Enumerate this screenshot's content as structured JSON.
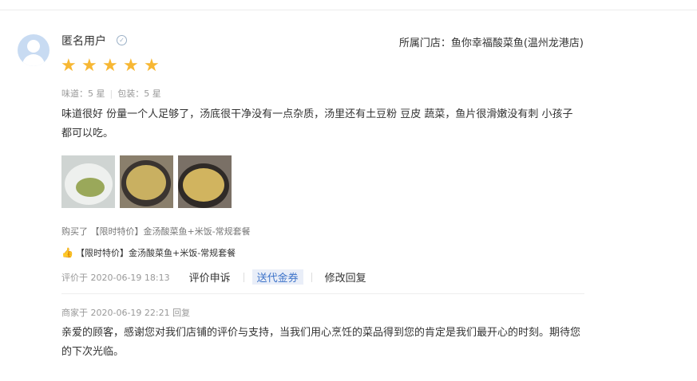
{
  "user": {
    "name": "匿名用户",
    "store": "所属门店：鱼你幸福酸菜鱼(温州龙港店)"
  },
  "rating": {
    "stars": 5,
    "max": 5
  },
  "sub_ratings": {
    "taste": "味道：5 星",
    "packaging": "包装：5 星"
  },
  "review": {
    "text": "味道很好 份量一个人足够了，汤底很干净没有一点杂质，汤里还有土豆粉 豆皮 蔬菜，鱼片很滑嫩没有刺 小孩子都可以吃。"
  },
  "photos": [
    {
      "alt": "rice-dish-photo"
    },
    {
      "alt": "fish-soup-photo"
    },
    {
      "alt": "fish-soup-photo-2"
    }
  ],
  "purchase": {
    "text": "购买了 【限时特价】金汤酸菜鱼+米饭-常规套餐",
    "liked_dish": "【限时特价】金汤酸菜鱼+米饭-常规套餐"
  },
  "actions": {
    "time": "评价于 2020-06-19 18:13",
    "complain": "评价申诉",
    "coupon": "送代金券",
    "edit_reply": "修改回复"
  },
  "merchant": {
    "meta": "商家于 2020-06-19 22:21 回复",
    "reply": "亲爱的顾客，感谢您对我们店铺的评价与支持，当我们用心烹饪的菜品得到您的肯定是我们最开心的时刻。期待您的下次光临。"
  },
  "colors": {
    "star": "#f7b733",
    "link_blue": "#3d73c9",
    "thumb": "#f2993a"
  },
  "icons": {
    "avatar": "user-avatar-icon",
    "verified": "verified-icon",
    "star": "star-icon",
    "thumb": "thumbs-up-icon"
  }
}
